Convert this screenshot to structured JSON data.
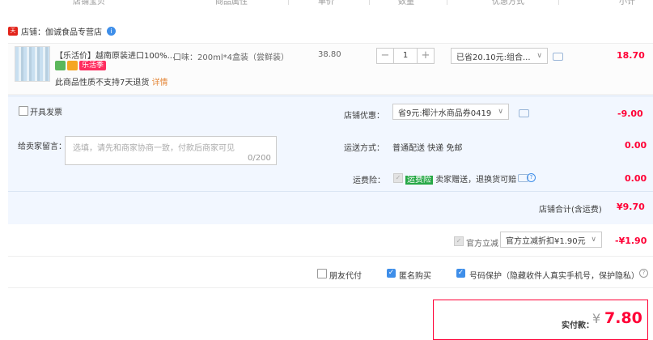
{
  "header": {
    "columns": [
      "店铺宝贝",
      "商品属性",
      "单价",
      "数量",
      "优惠方式",
      "小计"
    ]
  },
  "shop": {
    "icon_label": "天猫",
    "label": "店铺：",
    "name": "伽诚食品专营店",
    "badge": "i"
  },
  "item": {
    "title": "【乐活价】越南原装进口100%...",
    "badges": [
      "乐活季"
    ],
    "return_note": "此商品性质不支持7天退货",
    "return_link": "详情",
    "spec": "口味：200ml*4盒装（尝鲜装）",
    "unit_price": "38.80",
    "quantity": "1",
    "minus": "−",
    "plus": "+",
    "discount_select": "已省20.10元:组合...",
    "subtotal": "18.70"
  },
  "options": {
    "invoice_label": "开具发票",
    "message_label": "给卖家留言：",
    "message_placeholder": "选填，请先和商家协商一致，付款后商家可见",
    "message_count": "0/200",
    "shop_discount_label": "店铺优惠：",
    "shop_discount_select": "省9元:椰汁水商品券0419",
    "shop_discount_amount": "-9.00",
    "shipping_label": "运送方式：",
    "shipping_value": "普通配送 快递 免邮",
    "shipping_amount": "0.00",
    "insurance_label": "运费险：",
    "insurance_badge": "运费险",
    "insurance_text": "卖家赠送，退换货可赔",
    "insurance_amount": "0.00",
    "help_icon": "?"
  },
  "shop_total": {
    "label": "店铺合计(含运费)",
    "value": "¥9.70"
  },
  "platform": {
    "label": "官方立减",
    "select": "官方立减折扣¥1.90元",
    "amount": "-¥1.90"
  },
  "privacy": {
    "friend_pay": "朋友代付",
    "anonymous": "匿名购买",
    "number_protect": "号码保护（隐藏收件人真实手机号，保护隐私）"
  },
  "final": {
    "label": "实付款：",
    "currency": "¥",
    "value": "7.80"
  },
  "colors": {
    "accent_red": "#ff0036",
    "accent_blue": "#3e8ee9",
    "panel_bg": "#f2f7ff"
  }
}
